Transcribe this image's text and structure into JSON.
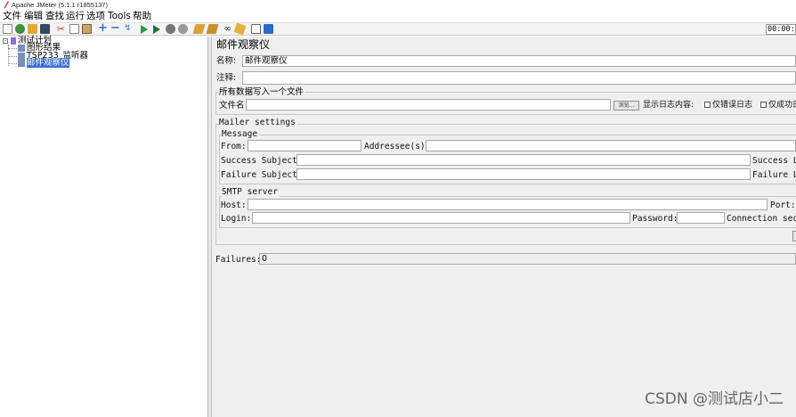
{
  "window": {
    "title": "Apache JMeter (5.1.1 r1855137)"
  },
  "menu": [
    "文件",
    "编辑",
    "查找",
    "运行",
    "选项",
    "Tools",
    "帮助"
  ],
  "toolbar": {
    "icons": [
      "new-icon",
      "templates-icon",
      "open-icon",
      "save-icon",
      "cut-icon",
      "copy-icon",
      "paste-icon",
      "expand-icon",
      "collapse-icon",
      "toggle-icon",
      "start-icon",
      "start-no-pause-icon",
      "stop-icon",
      "shutdown-icon",
      "clear-icon",
      "clear-all-icon",
      "search-icon",
      "reset-search-icon",
      "function-helper-icon",
      "help-icon"
    ],
    "timer": "00:00:"
  },
  "tree": {
    "root": "测试计划",
    "children": [
      "图形结果",
      "TSP233_监听器",
      "邮件观察仪"
    ]
  },
  "panel": {
    "title": "邮件观察仪",
    "name_label": "名称:",
    "name_value": "邮件观察仪",
    "comment_label": "注释:",
    "file_section": {
      "legend": "所有数据写入一个文件",
      "filename_label": "文件名",
      "browse_label": "浏览...",
      "log_label": "显示日志内容:",
      "errors_only": "仅错误日志",
      "success_only": "仅成功日"
    },
    "mailer": {
      "legend": "Mailer settings",
      "message_legend": "Message",
      "from_label": "From:",
      "addressee_label": "Addressee(s):",
      "success_subject_label": "Success Subject:",
      "success_limit_label": "Success Li",
      "failure_subject_label": "Failure Subject:",
      "failure_limit_label": "Failure Li",
      "smtp_legend": "SMTP server",
      "host_label": "Host:",
      "port_label": "Port:",
      "login_label": "Login:",
      "password_label": "Password:",
      "connection_label": "Connection secur"
    },
    "failures_label": "Failures:",
    "failures_value": "0"
  },
  "watermark": "CSDN @测试店小二"
}
